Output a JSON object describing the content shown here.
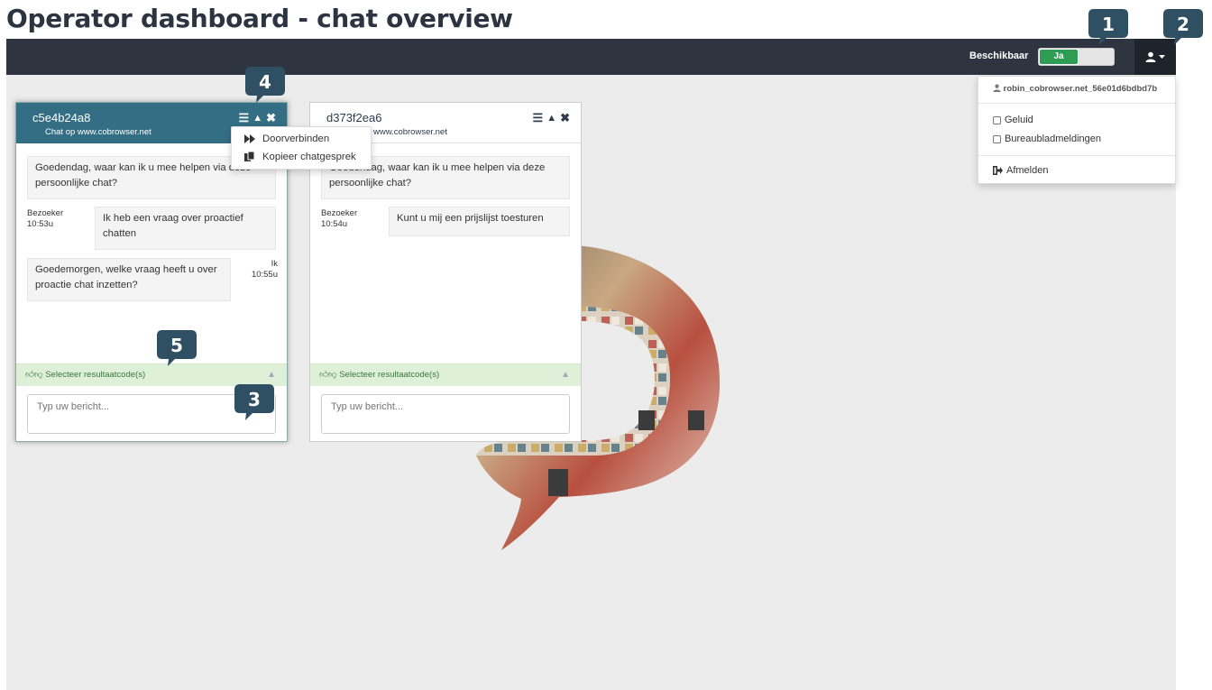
{
  "page_title": "Operator dashboard - chat overview",
  "navbar": {
    "availability_label": "Beschikbaar",
    "availability_value": "Ja"
  },
  "user_menu": {
    "username": "robin_cobrowser.net_56e01d6bdbd7b",
    "options": [
      {
        "label": "Geluid",
        "checked": false
      },
      {
        "label": "Bureaubladmeldingen",
        "checked": false
      }
    ],
    "logout_label": "Afmelden"
  },
  "chats": [
    {
      "id": "c5e4b24a8",
      "subtitle": "Chat op www.cobrowser.net",
      "messages": [
        {
          "text": "Goedendag, waar kan ik u mee helpen via deze persoonlijke chat?"
        },
        {
          "sender": "Bezoeker",
          "time": "10:53u",
          "text": "Ik heb een vraag over proactief chatten"
        },
        {
          "sender": "Ik",
          "time": "10:55u",
          "text": "Goedemorgen, welke vraag heeft u over proactie chat inzetten?"
        }
      ],
      "result_label": "Selecteer resultaatcode(s)",
      "input_placeholder": "Typ uw bericht..."
    },
    {
      "id": "d373f2ea6",
      "subtitle": "www.cobrowser.net",
      "messages": [
        {
          "text": "Goedendag, waar kan ik u mee helpen via deze persoonlijke chat?"
        },
        {
          "sender": "Bezoeker",
          "time": "10:54u",
          "text": "Kunt u mij een prijslijst toesturen"
        }
      ],
      "result_label": "Selecteer resultaatcode(s)",
      "input_placeholder": "Typ uw bericht..."
    }
  ],
  "context_menu": {
    "items": [
      {
        "label": "Doorverbinden",
        "icon": "fast-forward-icon"
      },
      {
        "label": "Kopieer chatgesprek",
        "icon": "copy-icon"
      }
    ]
  },
  "callouts": [
    "1",
    "2",
    "3",
    "4",
    "5"
  ],
  "colors": {
    "navbar": "#2e3540",
    "chat_header_active": "#346e84",
    "toggle_on": "#2f9e55",
    "callout": "#2f4f63",
    "result_bar": "#dff0d8"
  }
}
